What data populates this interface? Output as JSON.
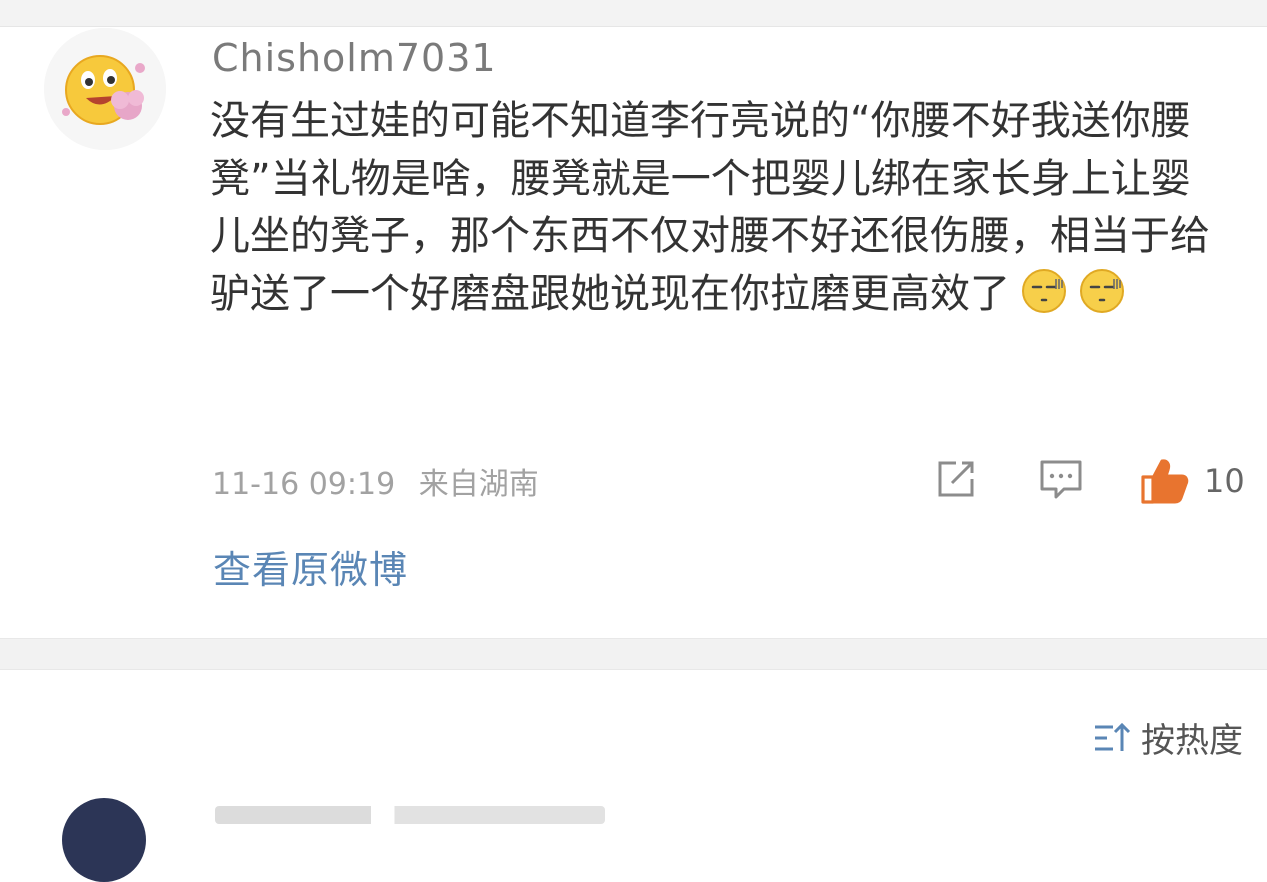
{
  "comment": {
    "username": "Chisholm7031",
    "text": "没有生过娃的可能不知道李行亮说的“你腰不好我送你腰凳”当礼物是啥，腰凳就是一个把婴儿绑在家长身上让婴儿坐的凳子，那个东西不仅对腰不好还很伤腰，相当于给驴送了一个好磨盘跟她说现在你拉磨更高效了",
    "emojis": [
      "sweat-smile-emoji",
      "sweat-smile-emoji"
    ],
    "timestamp": "11-16 09:19",
    "location": "来自湖南",
    "like_count": "10",
    "view_original": "查看原微博"
  },
  "sort": {
    "label": "按热度"
  },
  "colors": {
    "link": "#5a86b5",
    "like": "#e8742f",
    "meta": "#a2a2a2"
  }
}
